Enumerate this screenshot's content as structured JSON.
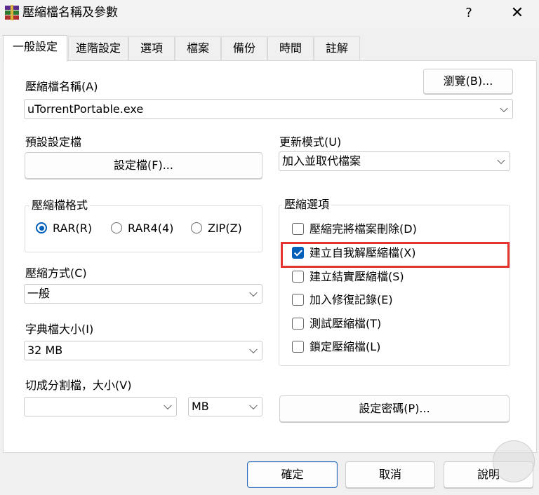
{
  "window": {
    "title": "壓縮檔名稱及參數",
    "help": "?",
    "close": "✕"
  },
  "tabs": [
    "一般設定",
    "進階設定",
    "選項",
    "檔案",
    "備份",
    "時間",
    "註解"
  ],
  "archive_name": {
    "label": "壓縮檔名稱(A)",
    "value": "uTorrentPortable.exe",
    "browse": "瀏覽(B)..."
  },
  "profile": {
    "label": "預設設定檔",
    "button": "設定檔(F)..."
  },
  "update_mode": {
    "label": "更新模式(U)",
    "value": "加入並取代檔案"
  },
  "format": {
    "label": "壓縮檔格式",
    "options": [
      "RAR(R)",
      "RAR4(4)",
      "ZIP(Z)"
    ],
    "selected": "RAR(R)"
  },
  "method": {
    "label": "壓縮方式(C)",
    "value": "一般"
  },
  "dictionary": {
    "label": "字典檔大小(I)",
    "value": "32 MB"
  },
  "split": {
    "label": "切成分割檔，大小(V)",
    "value": "",
    "unit": "MB"
  },
  "options": {
    "label": "壓縮選項",
    "items": [
      {
        "label": "壓縮完將檔案刪除(D)",
        "checked": false
      },
      {
        "label": "建立自我解壓縮檔(X)",
        "checked": true
      },
      {
        "label": "建立結實壓縮檔(S)",
        "checked": false
      },
      {
        "label": "加入修復記錄(E)",
        "checked": false
      },
      {
        "label": "測試壓縮檔(T)",
        "checked": false
      },
      {
        "label": "鎖定壓縮檔(L)",
        "checked": false
      }
    ]
  },
  "password_button": "設定密碼(P)...",
  "footer": {
    "ok": "確定",
    "cancel": "取消",
    "help": "說明"
  },
  "colors": {
    "accent": "#005fb8",
    "highlight": "#e3342f"
  }
}
